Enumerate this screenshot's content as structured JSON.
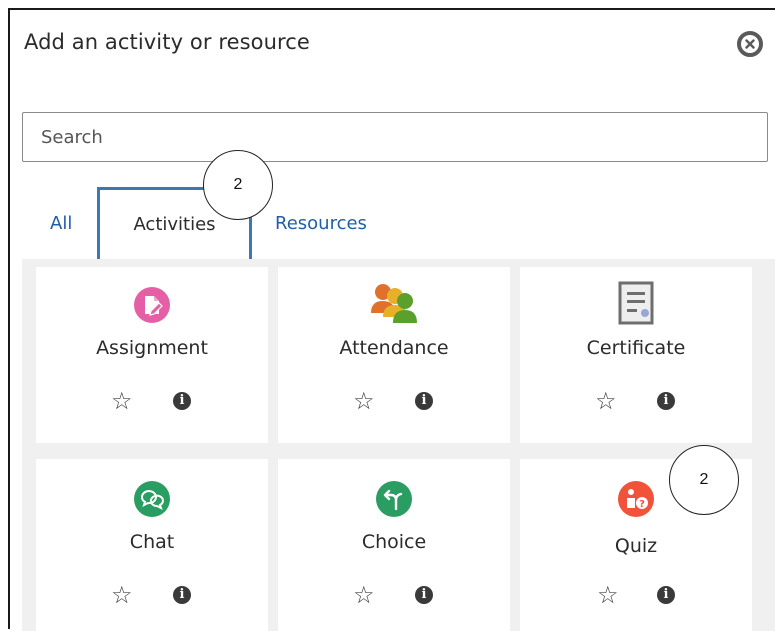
{
  "dialog": {
    "title": "Add an activity or resource",
    "close_icon": "close-circle-icon"
  },
  "search": {
    "placeholder": "Search",
    "value": ""
  },
  "tabs": [
    {
      "label": "All",
      "selected": false
    },
    {
      "label": "Activities",
      "selected": true
    },
    {
      "label": "Resources",
      "selected": false
    }
  ],
  "items": [
    {
      "name": "Assignment",
      "icon": "assignment-icon",
      "icon_color": "#e45fa5"
    },
    {
      "name": "Attendance",
      "icon": "attendance-icon",
      "icon_color": "#5aa02c"
    },
    {
      "name": "Certificate",
      "icon": "certificate-icon",
      "icon_color": "#7a7a7a"
    },
    {
      "name": "Chat",
      "icon": "chat-icon",
      "icon_color": "#2a9d62"
    },
    {
      "name": "Choice",
      "icon": "choice-icon",
      "icon_color": "#2a9d62"
    },
    {
      "name": "Quiz",
      "icon": "quiz-icon",
      "icon_color": "#f0523a"
    }
  ],
  "callouts": [
    {
      "label": "2",
      "target": "tab-activities"
    },
    {
      "label": "2",
      "target": "quiz-card"
    }
  ],
  "colors": {
    "link": "#1f5fa8",
    "selected_tab_border": "#3b78b5",
    "grid_background": "#f0f0f0"
  }
}
